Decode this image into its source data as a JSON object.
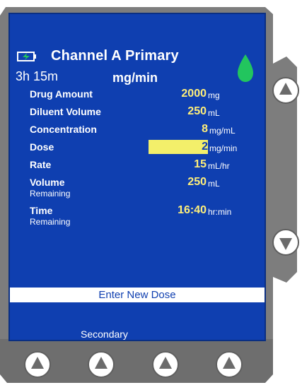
{
  "header": {
    "channel_title": "Channel A Primary",
    "time_left": "3h 15m",
    "units_title": "mg/min"
  },
  "rows": {
    "drug_amount": {
      "label": "Drug Amount",
      "value": "2000",
      "unit": "mg"
    },
    "diluent_volume": {
      "label": "Diluent Volume",
      "value": "250",
      "unit": "mL"
    },
    "concentration": {
      "label": "Concentration",
      "value": "8",
      "unit": "mg/mL"
    },
    "dose": {
      "label": "Dose",
      "value": "2",
      "unit": "mg/min"
    },
    "rate": {
      "label": "Rate",
      "value": "15",
      "unit": "mL/hr"
    },
    "volume": {
      "label": "Volume",
      "sub": "Remaining",
      "value": "250",
      "unit": "mL"
    },
    "time": {
      "label": "Time",
      "sub": "Remaining",
      "value": "16:40",
      "unit": "hr:min"
    }
  },
  "prompt": "Enter New Dose",
  "softkey": {
    "label": "Secondary"
  },
  "colors": {
    "screen": "#0f3fb0",
    "value": "#ffef7a",
    "edit_highlight": "#f3ef6a",
    "drop": "#22c55e",
    "bezel": "#808080"
  },
  "icons": [
    "battery-charging-icon",
    "drop-icon",
    "up-arrow-icon",
    "down-arrow-icon"
  ]
}
